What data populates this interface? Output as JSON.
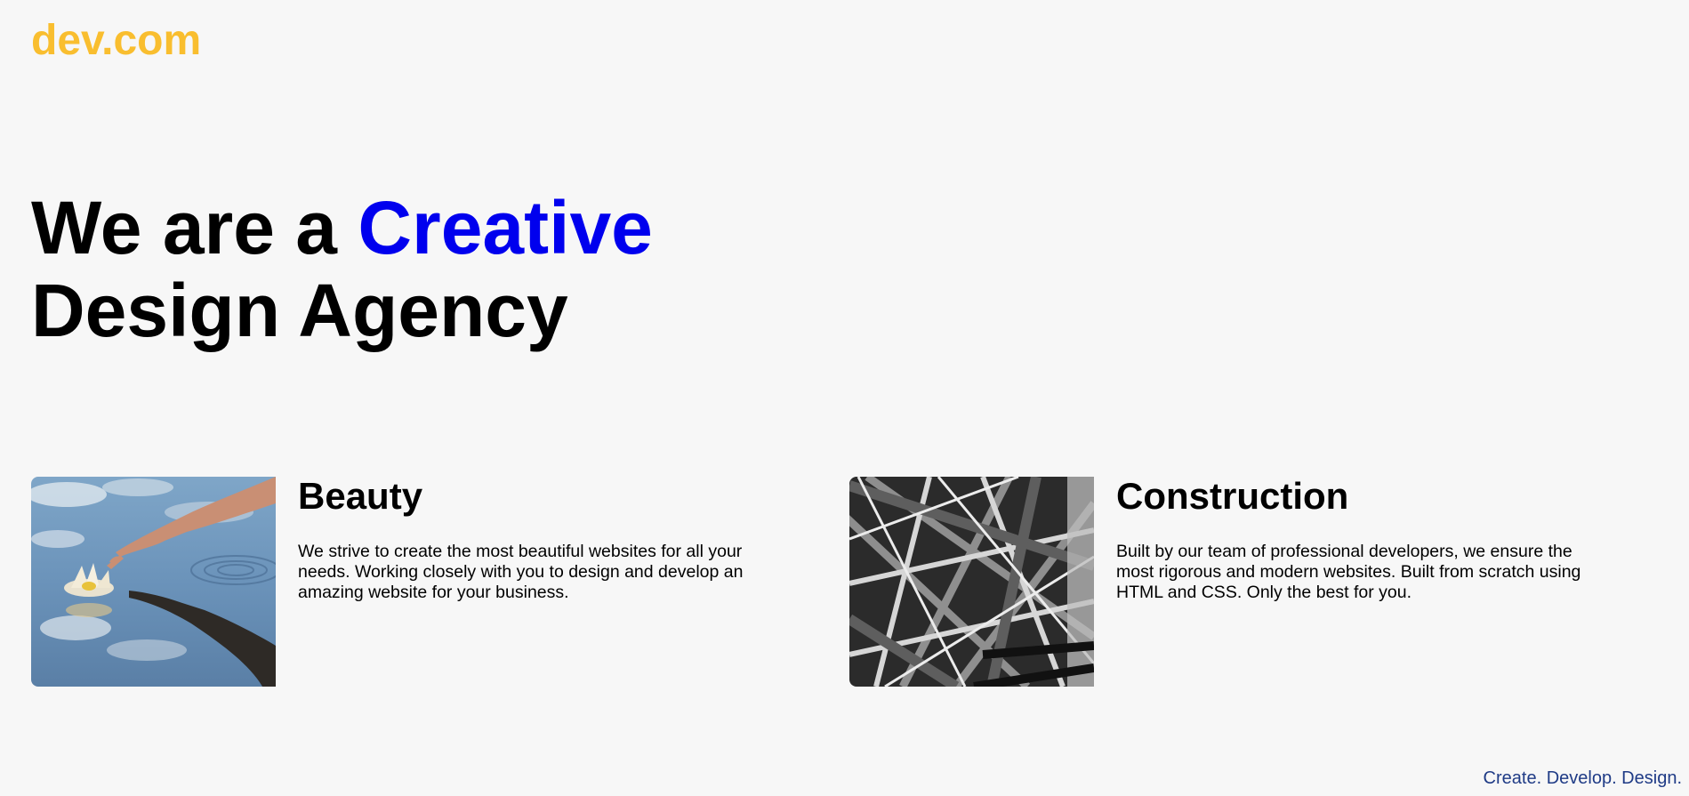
{
  "header": {
    "logo": "dev.com",
    "logo_color": "#f9be2f"
  },
  "hero": {
    "line1_prefix": "We are a ",
    "line1_accent": "Creative",
    "line2": "Design Agency",
    "accent_color": "#0000ee"
  },
  "cards": [
    {
      "title": "Beauty",
      "description": "We strive to create the most beautiful websites for all your needs. Working closely with you to design and develop an amazing website for your business.",
      "image": "hand-touching-water-lily-photo"
    },
    {
      "title": "Construction",
      "description": "Built by our team of professional developers, we ensure the most rigorous and modern websites. Built from scratch using HTML and CSS. Only the best for you.",
      "image": "steel-beams-bw-photo"
    }
  ],
  "footer": {
    "tagline": "Create. Develop. Design.",
    "tagline_color": "#1f3b86"
  }
}
